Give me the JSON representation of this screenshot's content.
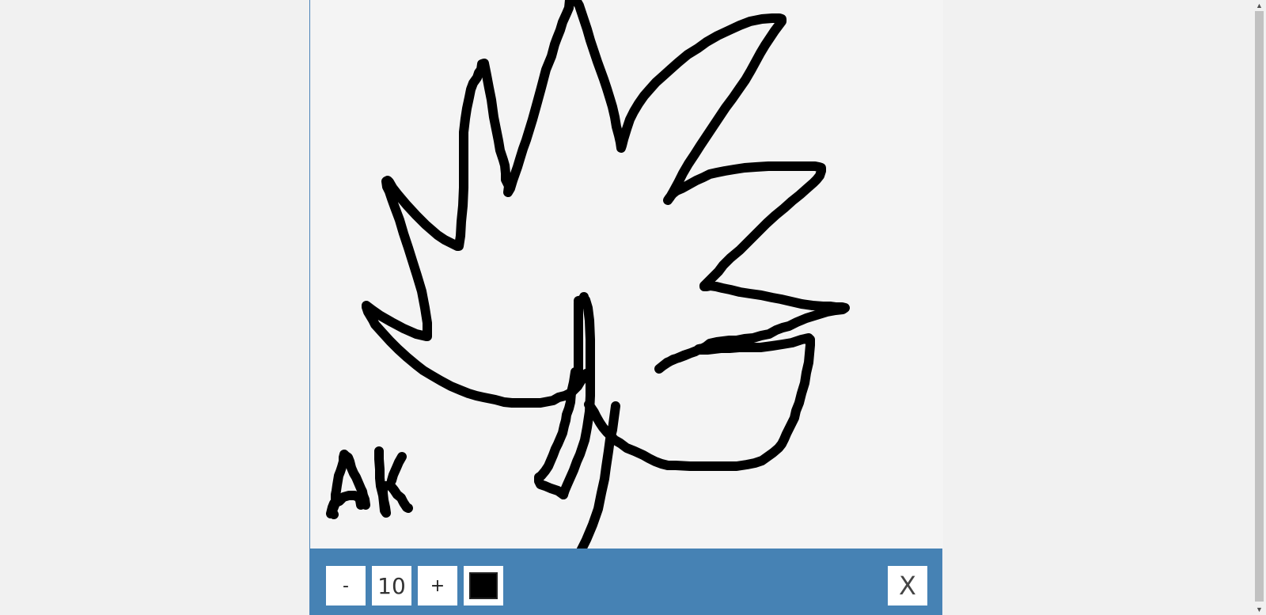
{
  "toolbar": {
    "decrease_label": "-",
    "brush_size": "10",
    "increase_label": "+",
    "close_label": "X",
    "brush_color": "#000000"
  },
  "colors": {
    "toolbar_background": "#4682b4",
    "canvas_background": "#f4f4f4",
    "page_background": "#f1f1f1",
    "stroke": "#000000"
  },
  "scrollbar": {
    "up_icon": "triangle-up-icon",
    "down_icon": "triangle-down-icon"
  }
}
